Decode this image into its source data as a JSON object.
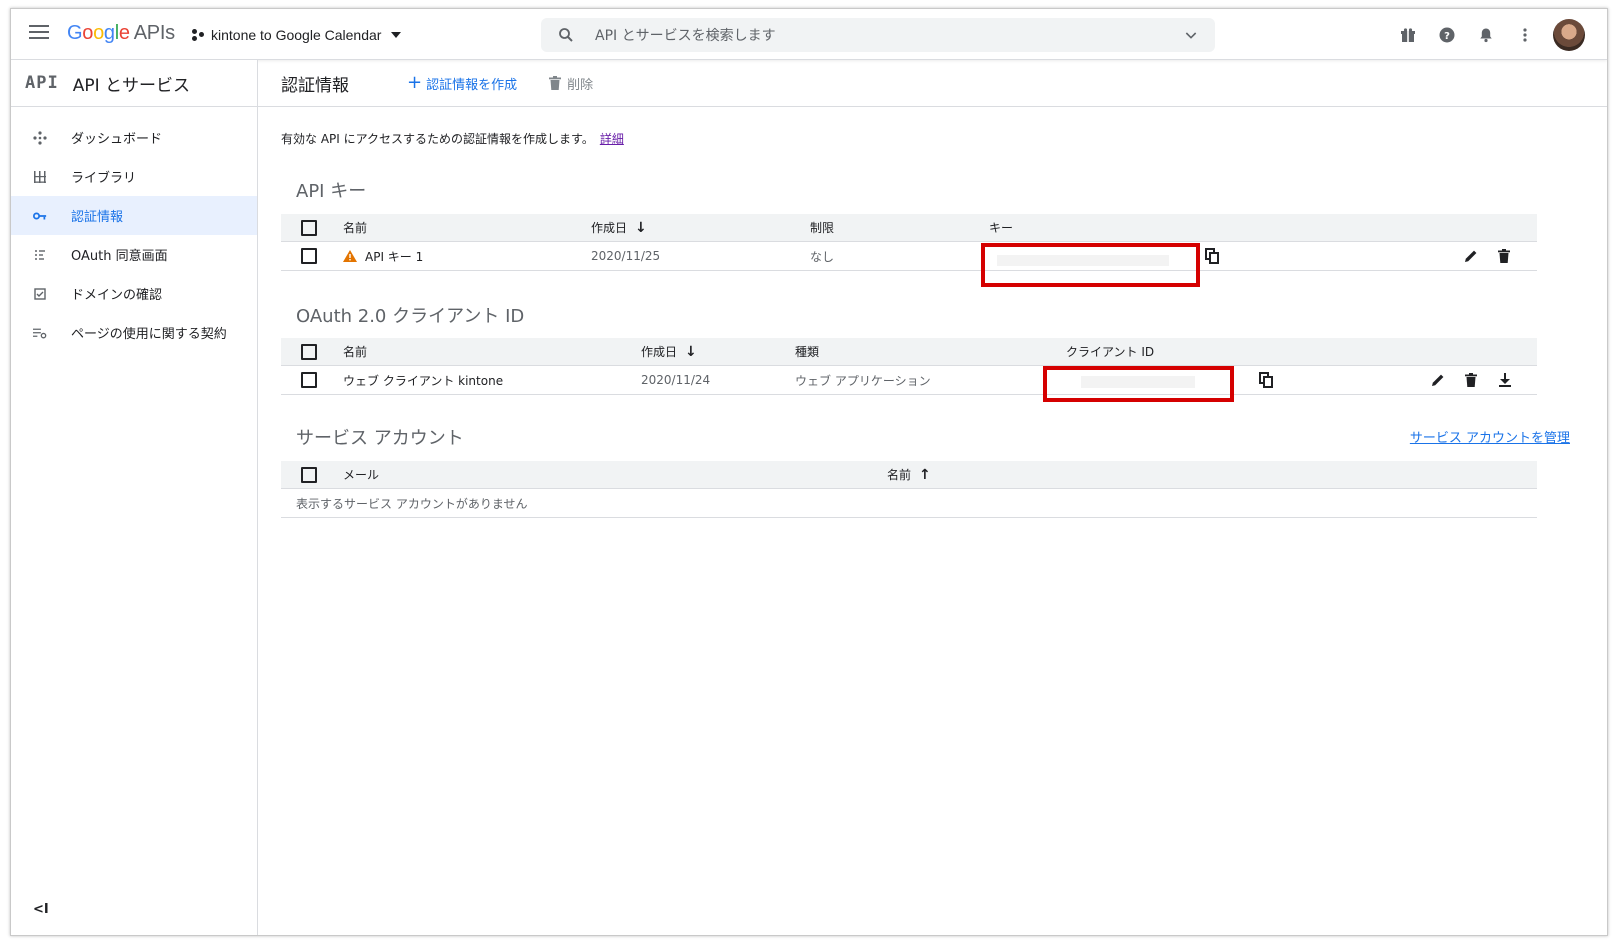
{
  "topbar": {
    "logo_google": [
      "G",
      "o",
      "o",
      "g",
      "l",
      "e"
    ],
    "logo_apis": "APIs",
    "project_name": "kintone to Google Calendar",
    "search_placeholder": "API とサービスを検索します"
  },
  "sidebar": {
    "mark": "API",
    "title": "API とサービス",
    "items": [
      {
        "label": "ダッシュボード",
        "icon": "dashboard-icon",
        "active": false
      },
      {
        "label": "ライブラリ",
        "icon": "library-icon",
        "active": false
      },
      {
        "label": "認証情報",
        "icon": "key-icon",
        "active": true
      },
      {
        "label": "OAuth 同意画面",
        "icon": "oauth-consent-icon",
        "active": false
      },
      {
        "label": "ドメインの確認",
        "icon": "domain-verify-icon",
        "active": false
      },
      {
        "label": "ページの使用に関する契約",
        "icon": "page-usage-icon",
        "active": false
      }
    ],
    "collapse_label": "<I"
  },
  "main": {
    "title": "認証情報",
    "create_label": "認証情報を作成",
    "delete_label": "削除",
    "intro_text": "有効な API にアクセスするための認証情報を作成します。",
    "intro_link": "詳細"
  },
  "api_keys": {
    "title": "API キー",
    "headers": {
      "name": "名前",
      "created": "作成日",
      "restriction": "制限",
      "key": "キー"
    },
    "rows": [
      {
        "name": "API キー 1",
        "created": "2020/11/25",
        "restriction": "なし"
      }
    ]
  },
  "oauth": {
    "title": "OAuth 2.0 クライアント ID",
    "headers": {
      "name": "名前",
      "created": "作成日",
      "type": "種類",
      "client_id": "クライアント ID"
    },
    "rows": [
      {
        "name": "ウェブ クライアント kintone",
        "created": "2020/11/24",
        "type": "ウェブ アプリケーション"
      }
    ]
  },
  "service_accounts": {
    "title": "サービス アカウント",
    "manage_link": "サービス アカウントを管理",
    "headers": {
      "email": "メール",
      "name": "名前"
    },
    "empty_text": "表示するサービス アカウントがありません"
  },
  "colors": {
    "accent": "#1a73e8",
    "highlight_box": "#d50000",
    "warning": "#e37400",
    "active_bg": "#e8f0fe"
  }
}
